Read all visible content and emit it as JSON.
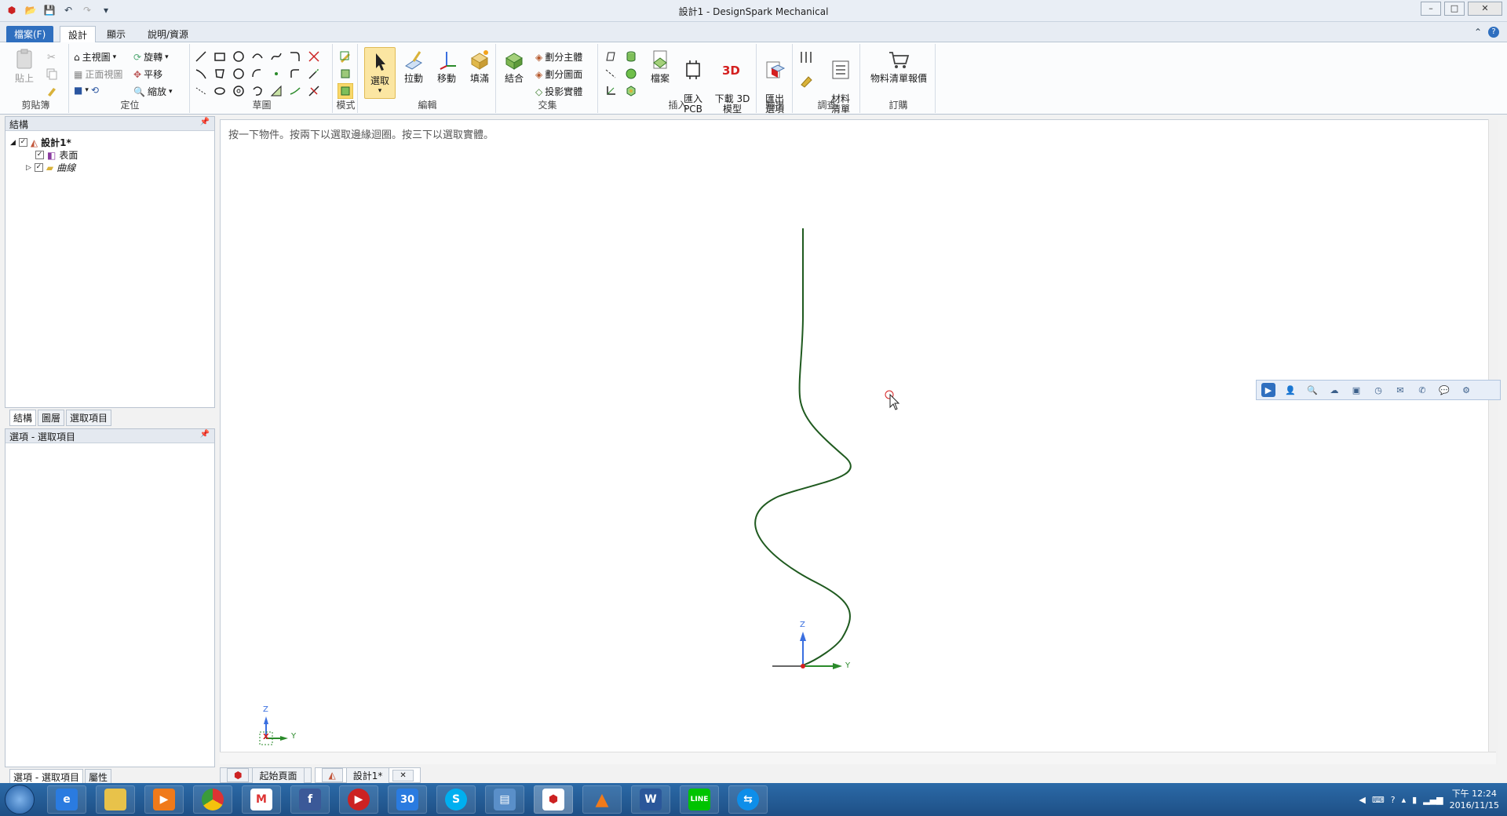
{
  "window": {
    "title": "設計1 - DesignSpark Mechanical",
    "controls": [
      "minimize-icon",
      "maximize-icon",
      "close-icon"
    ]
  },
  "ribbon_tabs": {
    "file": "檔案(F)",
    "design": "設計",
    "display": "顯示",
    "help": "說明/資源"
  },
  "ribbon": {
    "clipboard": {
      "paste": "貼上",
      "label": "剪貼簿"
    },
    "orient": {
      "home": "主視圖",
      "front": "正面視圖",
      "spin": "旋轉",
      "pan": "平移",
      "zoom": "縮放",
      "label": "定位"
    },
    "sketch": {
      "label": "草圖"
    },
    "mode": {
      "label": "模式"
    },
    "edit": {
      "select": "選取",
      "pull": "拉動",
      "move": "移動",
      "fill": "填滿",
      "label": "編輯"
    },
    "intersect": {
      "combine": "結合",
      "split_body": "劃分主體",
      "split_face": "劃分圖面",
      "project": "投影實體",
      "label": "交集"
    },
    "insert": {
      "file": "檔案",
      "import_pcb": "匯入\nPCB",
      "download_3d": "下載 3D\n模型",
      "label": "插入"
    },
    "output": {
      "export": "匯出\n選項",
      "label": "輸出"
    },
    "investigate": {
      "materials": "材料\n清單",
      "label": "調查"
    },
    "order": {
      "bom_quote": "物料清單報價",
      "label": "訂購"
    }
  },
  "structure_panel": {
    "title": "結構",
    "tree": [
      {
        "label": "設計1*",
        "level": 0,
        "checked": true
      },
      {
        "label": "表面",
        "level": 1,
        "checked": true
      },
      {
        "label": "曲線",
        "level": 1,
        "checked": true
      }
    ],
    "tabs": [
      "結構",
      "圖層",
      "選取項目"
    ]
  },
  "options_panel": {
    "title": "選項 - 選取項目",
    "tabs": [
      "選項 - 選取項目",
      "屬性"
    ]
  },
  "canvas": {
    "hint": "按一下物件。按兩下以選取邊緣迴圈。按三下以選取實體。",
    "axes": {
      "z": "Z",
      "y": "Y",
      "x": "X"
    }
  },
  "doc_tabs": [
    {
      "label": "起始頁面",
      "active": false
    },
    {
      "label": "設計1*",
      "active": true
    }
  ],
  "taskbar": {
    "apps": [
      "ie",
      "explorer",
      "media-player",
      "chrome",
      "gmail",
      "facebook",
      "video-player",
      "calendar",
      "skype",
      "network",
      "designspark",
      "vlc",
      "word",
      "line",
      "teamviewer"
    ],
    "calendar_day": "30",
    "clock_time": "下午 12:24",
    "clock_date": "2016/11/15"
  },
  "colors": {
    "accent": "#2f6fbf",
    "curve": "#1f5a1f",
    "axis_z": "#3a6fe0",
    "axis_y": "#2a8a2a",
    "axis_x": "#d42020"
  }
}
